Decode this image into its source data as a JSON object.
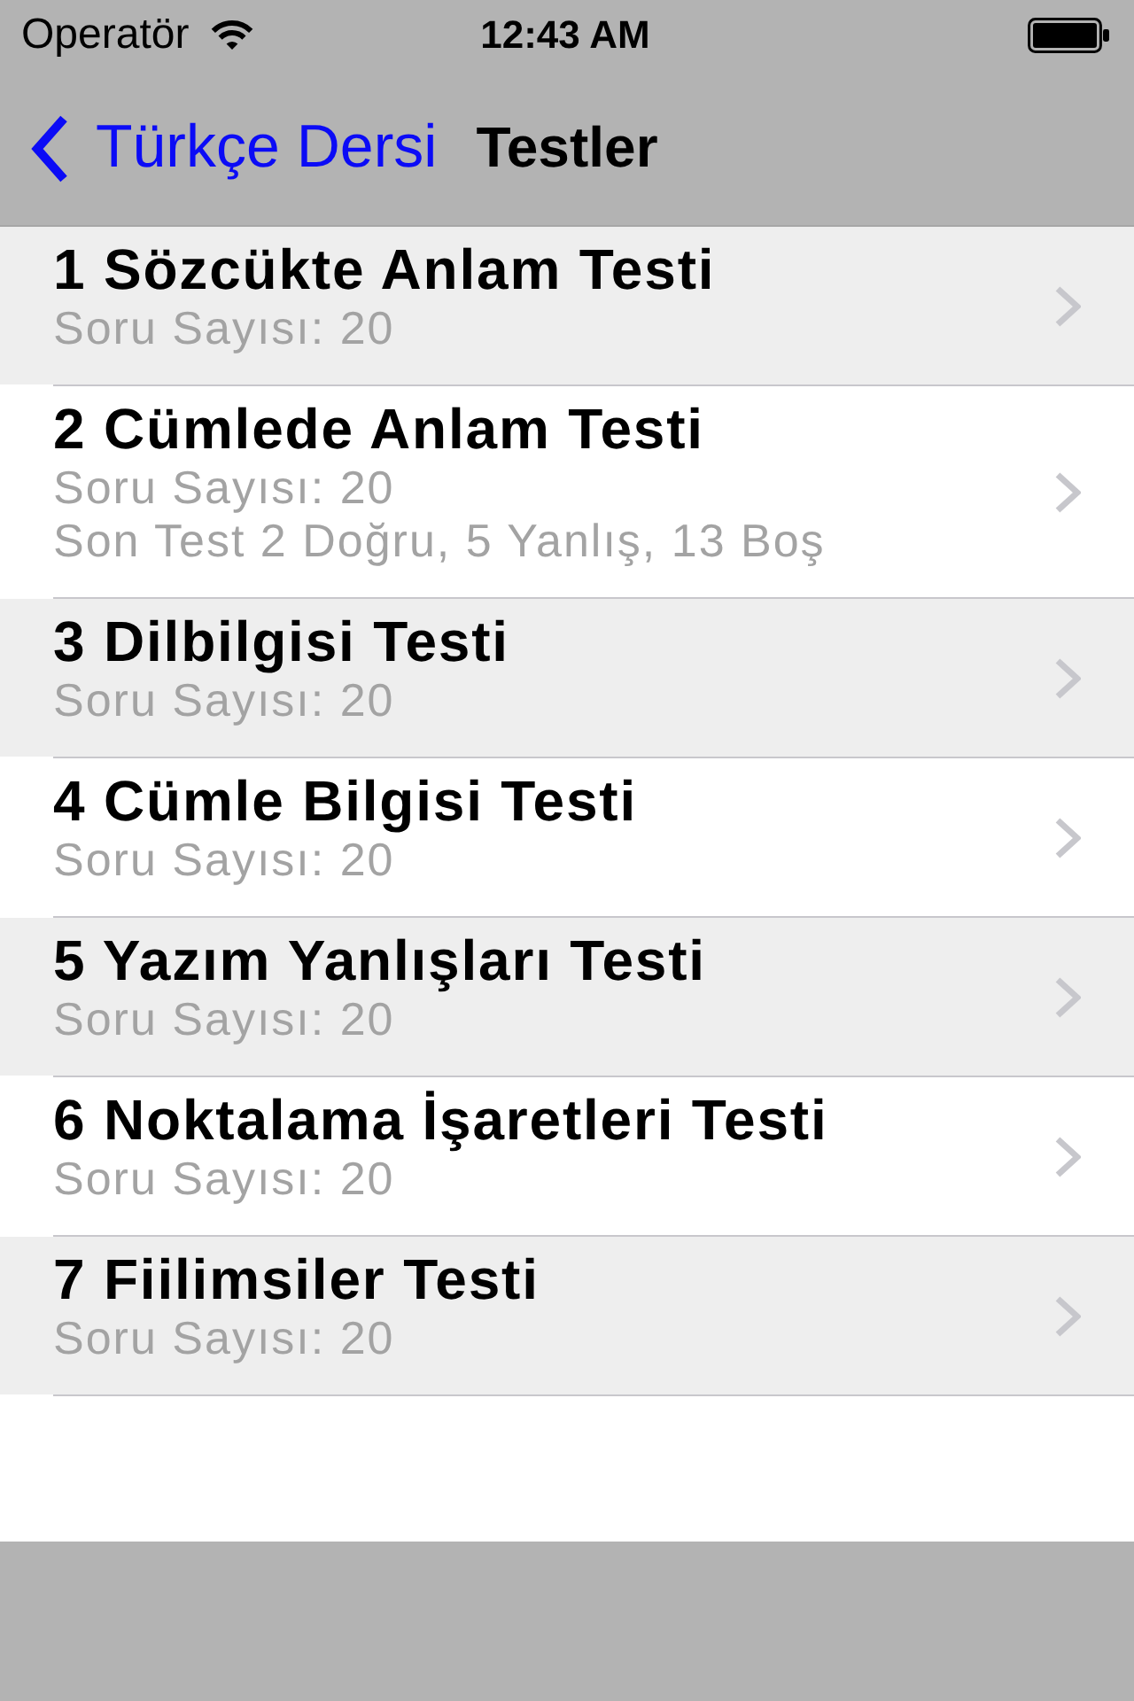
{
  "status_bar": {
    "carrier": "Operatör",
    "time": "12:43 AM"
  },
  "nav_bar": {
    "back_label": "Türkçe Dersi",
    "title": "Testler"
  },
  "tests": [
    {
      "title": "1 Sözcükte Anlam Testi",
      "details": [
        "Soru Sayısı: 20"
      ]
    },
    {
      "title": "2 Cümlede Anlam Testi",
      "details": [
        "Soru Sayısı: 20",
        "Son Test 2 Doğru, 5 Yanlış, 13 Boş"
      ]
    },
    {
      "title": "3 Dilbilgisi Testi",
      "details": [
        "Soru Sayısı: 20"
      ]
    },
    {
      "title": "4 Cümle Bilgisi Testi",
      "details": [
        "Soru Sayısı: 20"
      ]
    },
    {
      "title": "5 Yazım Yanlışları Testi",
      "details": [
        "Soru Sayısı: 20"
      ]
    },
    {
      "title": "6 Noktalama İşaretleri Testi",
      "details": [
        "Soru Sayısı: 20"
      ]
    },
    {
      "title": "7 Fiilimsiler Testi",
      "details": [
        "Soru Sayısı: 20"
      ]
    }
  ]
}
